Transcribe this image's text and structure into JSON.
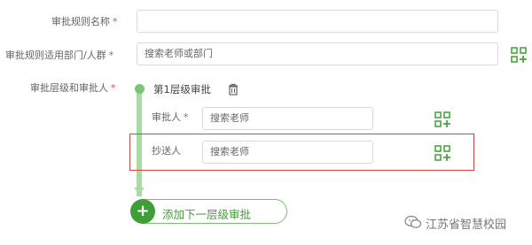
{
  "form": {
    "rule_name": {
      "label": "审批规则名称",
      "required_mark": "*",
      "value": ""
    },
    "scope": {
      "label": "审批规则适用部门/人群",
      "required_mark": "*",
      "placeholder": "搜索老师或部门"
    },
    "levels_label": {
      "label": "审批层级和审批人",
      "required_mark": "*"
    },
    "level1": {
      "title": "第1层级审批",
      "approver": {
        "label": "审批人",
        "required_mark": "*",
        "placeholder": "搜索老师"
      },
      "cc": {
        "label": "抄送人",
        "placeholder": "搜索老师"
      }
    },
    "add_level_button": {
      "icon": "+",
      "label": "添加下一层级审批"
    }
  },
  "watermark": {
    "text": "江苏省智慧校园"
  },
  "colors": {
    "accent_green": "#3f9e35",
    "required_red": "#e3474b",
    "highlight_red": "#d64545"
  }
}
